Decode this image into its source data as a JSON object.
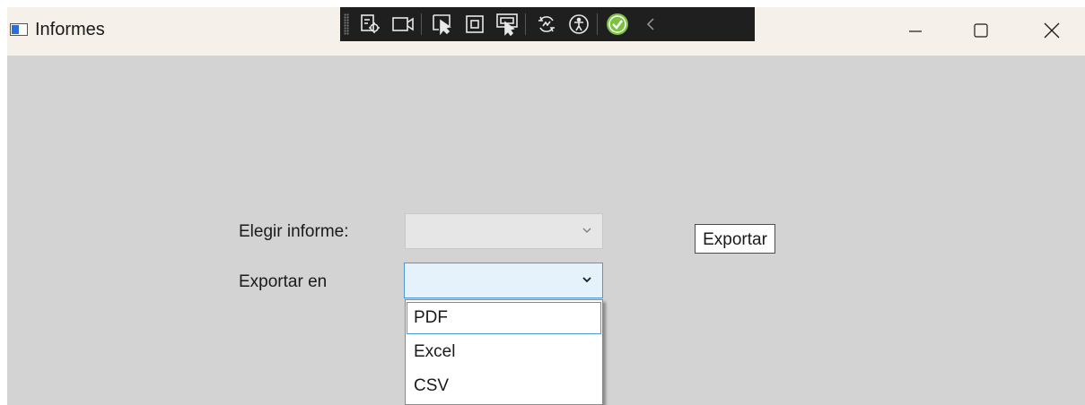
{
  "window": {
    "title": "Informes"
  },
  "devbar": {
    "icons": [
      "live-visual-tree-icon",
      "record-icon",
      "select-element-icon",
      "display-adorners-icon",
      "track-focus-icon",
      "hot-reload-icon",
      "accessibility-icon",
      "binding-ok-icon",
      "collapse-icon"
    ]
  },
  "form": {
    "informe_label": "Elegir informe:",
    "formato_label": "Exportar en",
    "informe_value": "",
    "formato_value": "",
    "export_button": "Exportar"
  },
  "dropdown": {
    "options": [
      "PDF",
      "Excel",
      "CSV"
    ],
    "selected": "PDF"
  },
  "colors": {
    "background": "#d3d3d3",
    "titlebar": "#f5f1ea",
    "accent": "#4a9ad8",
    "devbar": "#1f1f1f"
  }
}
